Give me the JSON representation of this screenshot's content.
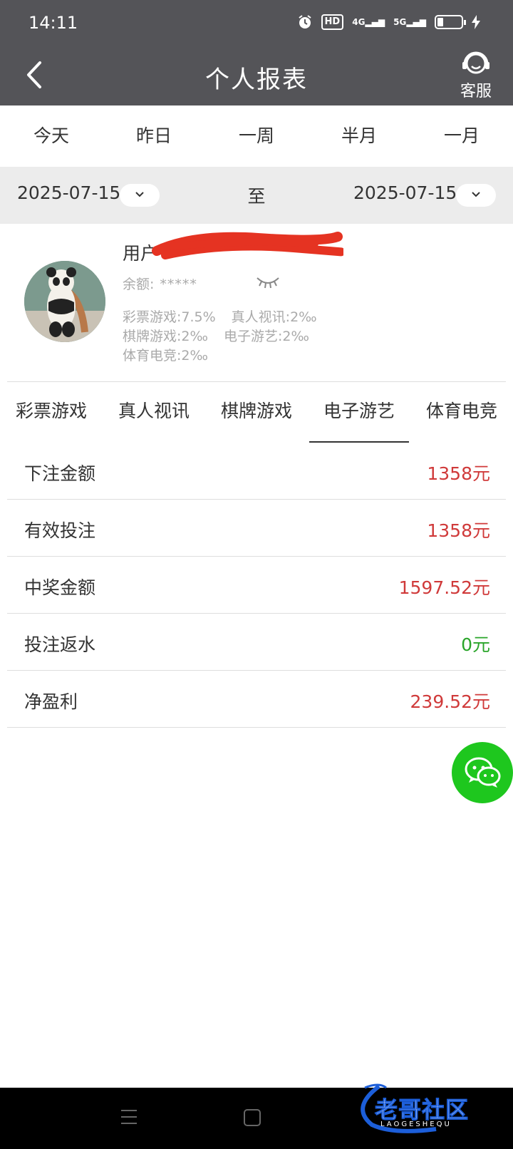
{
  "status_bar": {
    "time": "14:11",
    "hd_label": "HD",
    "net_4g": "4G",
    "net_5g": "5G"
  },
  "navbar": {
    "title": "个人报表",
    "service_label": "客服"
  },
  "range_tabs": [
    "今天",
    "昨日",
    "一周",
    "半月",
    "一月"
  ],
  "date_range": {
    "start": "2025-07-15",
    "separator": "至",
    "end": "2025-07-15"
  },
  "profile": {
    "username_prefix": "用户",
    "balance_label": "余额:",
    "balance_value": "*****",
    "rates": [
      [
        "彩票游戏:7.5%",
        "真人视讯:2‰"
      ],
      [
        "棋牌游戏:2‰",
        "电子游艺:2‰"
      ],
      [
        "体育电竞:2‰"
      ]
    ]
  },
  "category_tabs": {
    "items": [
      "彩票游戏",
      "真人视讯",
      "棋牌游戏",
      "电子游艺",
      "体育电竞"
    ],
    "active_index": 3
  },
  "stats": [
    {
      "label": "下注金额",
      "value": "1358元",
      "color": "#d03a3a"
    },
    {
      "label": "有效投注",
      "value": "1358元",
      "color": "#d03a3a"
    },
    {
      "label": "中奖金额",
      "value": "1597.52元",
      "color": "#d03a3a"
    },
    {
      "label": "投注返水",
      "value": "0元",
      "color": "#2aa52a"
    },
    {
      "label": "净盈利",
      "value": "239.52元",
      "color": "#d03a3a"
    }
  ],
  "watermark": {
    "text": "老哥社区",
    "sub": "LAOGESHEQU"
  },
  "colors": {
    "header_bg": "#545458",
    "date_row_bg": "#ececec",
    "positive": "#d03a3a",
    "zero": "#2aa52a",
    "fab": "#1ec71e",
    "redaction": "#e53322"
  }
}
